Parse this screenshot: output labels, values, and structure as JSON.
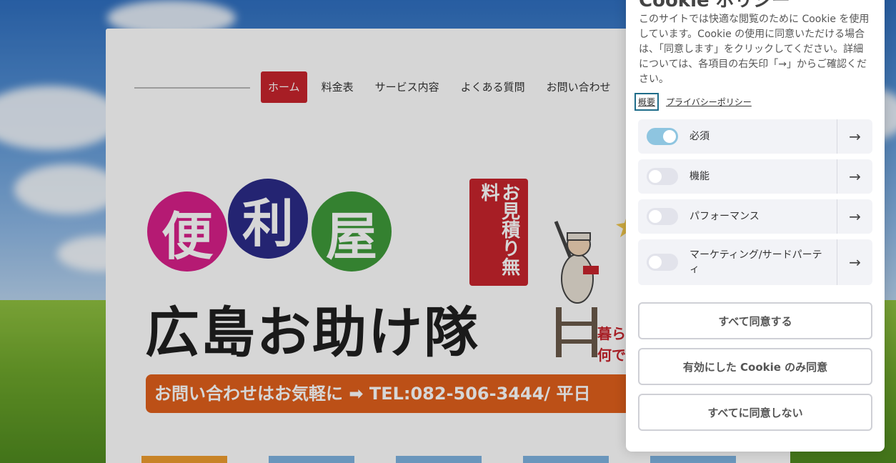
{
  "nav": {
    "items": [
      {
        "label": "ホーム",
        "active": true
      },
      {
        "label": "料金表",
        "active": false
      },
      {
        "label": "サービス内容",
        "active": false
      },
      {
        "label": "よくある質問",
        "active": false
      },
      {
        "label": "お問い合わせ",
        "active": false
      }
    ]
  },
  "hero": {
    "circle_chars": [
      "便",
      "利",
      "屋"
    ],
    "title": "広島お助け隊",
    "estimate_badge": "お見積り無料",
    "side_text_1": "暮らし",
    "side_text_2": "何で",
    "promo": "お問い合わせはお気軽に ➡ TEL:082-506-3444/ 平日"
  },
  "cookie": {
    "title": "Cookie ポリシー",
    "description": "このサイトでは快適な閲覧のために Cookie を使用しています。Cookie の使用に同意いただける場合は、「同意します」をクリックしてください。詳細については、各項目の右矢印「→」からご確認ください。",
    "link_overview": "概要",
    "link_privacy": "プライバシーポリシー",
    "categories": [
      {
        "label": "必須",
        "enabled": true
      },
      {
        "label": "機能",
        "enabled": false
      },
      {
        "label": "パフォーマンス",
        "enabled": false
      },
      {
        "label": "マーケティング/サードパーティ",
        "enabled": false
      }
    ],
    "arrow_glyph": "→",
    "buttons": {
      "accept_all": "すべて同意する",
      "accept_selected": "有効にした Cookie のみ同意",
      "reject_all": "すべてに同意しない"
    }
  },
  "colors": {
    "accent_red": "#c7242d",
    "toggle_on": "#8ec5e0",
    "promo_orange": "#e0601c"
  }
}
